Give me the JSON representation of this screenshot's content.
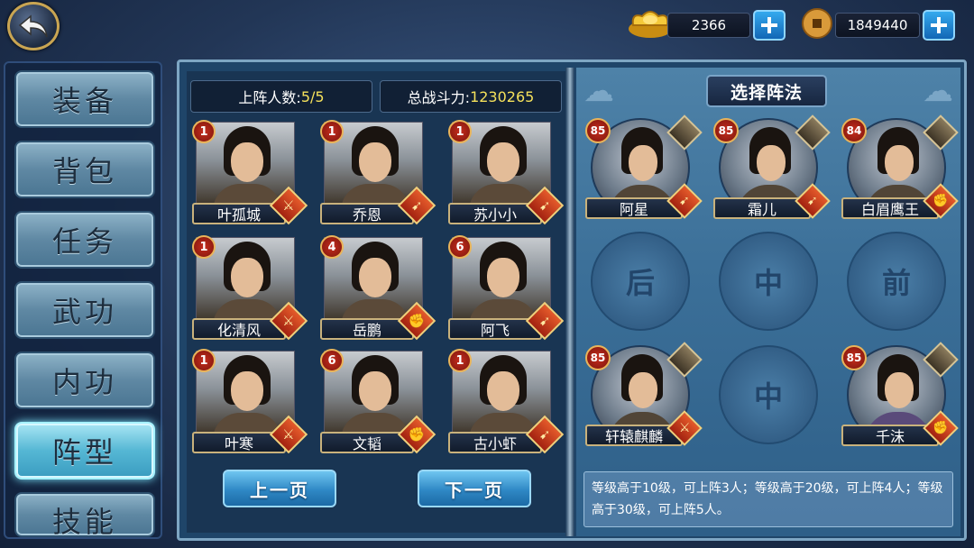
{
  "topbar": {
    "gold": "2366",
    "copper": "1849440"
  },
  "menu": [
    {
      "label": "装备",
      "name": "menu-equipment"
    },
    {
      "label": "背包",
      "name": "menu-bag"
    },
    {
      "label": "任务",
      "name": "menu-quest"
    },
    {
      "label": "武功",
      "name": "menu-martial"
    },
    {
      "label": "内功",
      "name": "menu-inner"
    },
    {
      "label": "阵型",
      "name": "menu-formation",
      "active": true
    },
    {
      "label": "技能",
      "name": "menu-skill"
    }
  ],
  "stats": {
    "deploy_label": "上阵人数:",
    "deploy_value": "5/5",
    "power_label": "总战斗力:",
    "power_value": "1230265"
  },
  "heroes": [
    {
      "name": "叶孤城",
      "level": "1",
      "type": "sword-icon"
    },
    {
      "name": "乔恩",
      "level": "1",
      "type": "spear-icon"
    },
    {
      "name": "苏小小",
      "level": "1",
      "type": "spear-icon"
    },
    {
      "name": "化清风",
      "level": "1",
      "type": "sword-icon"
    },
    {
      "name": "岳鹏",
      "level": "4",
      "type": "fist-icon"
    },
    {
      "name": "阿飞",
      "level": "6",
      "type": "spear-icon"
    },
    {
      "name": "叶寒",
      "level": "1",
      "type": "sword-icon"
    },
    {
      "name": "文韬",
      "level": "6",
      "type": "fist-icon"
    },
    {
      "name": "古小虾",
      "level": "1",
      "type": "spear-icon"
    }
  ],
  "pager": {
    "prev": "上一页",
    "next": "下一页"
  },
  "formation": {
    "title": "选择阵法",
    "row1": [
      {
        "name": "阿星",
        "level": "85",
        "type": "spear-icon"
      },
      {
        "name": "霜儿",
        "level": "85",
        "type": "spear-icon"
      },
      {
        "name": "白眉鹰王",
        "level": "84",
        "type": "fist-icon"
      }
    ],
    "empty_slots": [
      "后",
      "中",
      "前"
    ],
    "row3_left": {
      "name": "轩辕麒麟",
      "level": "85",
      "type": "sword-icon"
    },
    "row3_mid": "中",
    "row3_right": {
      "name": "千沫",
      "level": "85",
      "type": "fist-icon"
    },
    "info": "等级高于10级，可上阵3人；等级高于20级，可上阵4人；等级高于30级，可上阵5人。"
  }
}
